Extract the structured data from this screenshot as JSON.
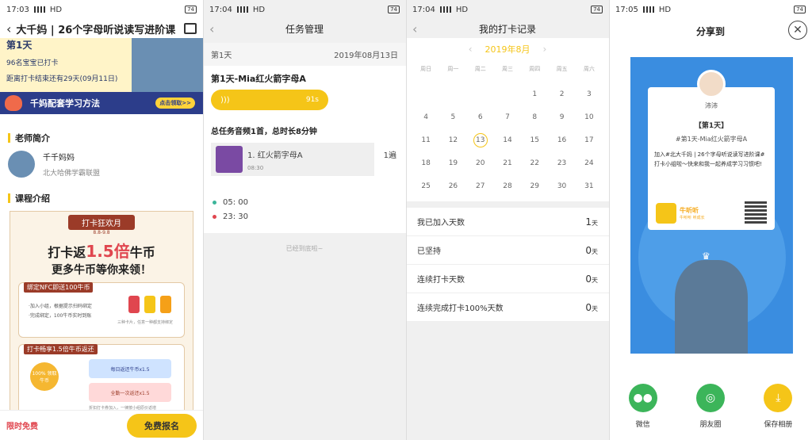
{
  "status_bars": [
    {
      "time": "17:03",
      "net": "HD",
      "battery": "74"
    },
    {
      "time": "17:04",
      "net": "HD",
      "battery": "74"
    },
    {
      "time": "17:04",
      "net": "HD",
      "battery": "74"
    },
    {
      "time": "17:05",
      "net": "HD",
      "battery": "74"
    }
  ],
  "course_page": {
    "title": "大千妈 | 26个字母听说读写进阶课",
    "hero": {
      "day": "第1天",
      "count": "96名宝宝已打卡",
      "remain": "距离打卡结束还有29天(09月11日)"
    },
    "banner": {
      "text": "千妈配套学习方法",
      "go": "点击领取>>"
    },
    "teacher_heading": "老师简介",
    "teacher": {
      "name": "千千妈妈",
      "org": "北大哈佛学霸联盟"
    },
    "course_heading": "课程介绍",
    "poster": {
      "tag": "打卡狂欢月",
      "dates": "8.8-9.8",
      "headline_pre": "打卡返",
      "headline_num": "1.5倍",
      "headline_post": "牛币",
      "headline2": "更多牛币等你来领！",
      "box1_tag": "绑定NFC即送100牛币",
      "box1_line1": "·加入小组，根据提示扫码绑定",
      "box1_line2": "·完成绑定，100牛币实时到账",
      "box1_note": "三种卡片，任意一种都支持绑定",
      "box2_tag": "打卡畅享1.5倍牛币返还",
      "box2_coin": "100%\n领取牛币",
      "box2_strip1": "每日返还牛币x1.5",
      "box2_strip2": "全勤一次返还x1.5",
      "box2_note": "折扣打卡券加入，一律按小组原价返增"
    },
    "footer": {
      "free": "限时免费",
      "cta": "免费报名"
    }
  },
  "task_page": {
    "nav_title": "任务管理",
    "day": "第1天",
    "date": "2019年08月13日",
    "task_title": "第1天-Mia红火箭字母A",
    "audio_duration": "91s",
    "total": "总任务音频1首，总时长8分钟",
    "item": {
      "title": "1. 红火箭字母A",
      "duration": "08:30",
      "repeat": "1遍"
    },
    "times": [
      "05: 00",
      "23: 30"
    ],
    "end": "已经到底啦~"
  },
  "checkin_page": {
    "nav_title": "我的打卡记录",
    "month": "2019年8月",
    "weekdays": [
      "周日",
      "周一",
      "周二",
      "周三",
      "周四",
      "周五",
      "周六"
    ],
    "days": [
      "",
      "",
      "",
      "",
      "1",
      "2",
      "3",
      "4",
      "5",
      "6",
      "7",
      "8",
      "9",
      "10",
      "11",
      "12",
      "13",
      "14",
      "15",
      "16",
      "17",
      "18",
      "19",
      "20",
      "21",
      "22",
      "23",
      "24",
      "25",
      "26",
      "27",
      "28",
      "29",
      "30",
      "31"
    ],
    "today": "13",
    "stats": [
      {
        "label": "我已加入天数",
        "value": "1",
        "unit": "天"
      },
      {
        "label": "已坚持",
        "value": "0",
        "unit": "天"
      },
      {
        "label": "连续打卡天数",
        "value": "0",
        "unit": "天"
      },
      {
        "label": "连续完成打卡100%天数",
        "value": "0",
        "unit": "天"
      }
    ]
  },
  "share_page": {
    "title": "分享到",
    "card": {
      "name": "沛沛",
      "day": "【第1天】",
      "lesson": "#第1天-Mia红火箭字母A",
      "desc": "加入#北大千妈 | 26个字母听说读写进阶课#打卡小组啦～快来和我一起养成学习习惯吧!",
      "brand": "牛听听",
      "brand_sub": "牛听听 听成长"
    },
    "buttons": [
      {
        "label": "微信",
        "color": "#3cb55a",
        "icon": "wechat-icon"
      },
      {
        "label": "朋友圈",
        "color": "#3cb55a",
        "icon": "moments-icon"
      },
      {
        "label": "保存相册",
        "color": "#f5c518",
        "icon": "download-icon"
      }
    ]
  },
  "colors": {
    "accent": "#f5c518",
    "share_bg": "#3a8de0",
    "red": "#e0464f"
  }
}
